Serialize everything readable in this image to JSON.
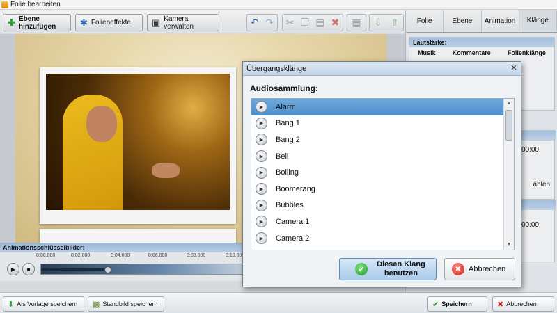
{
  "window": {
    "title": "Folie bearbeiten"
  },
  "toolbar": {
    "add_layer_label": "Ebene hinzufügen",
    "slide_effects_label": "Folieneffekte",
    "camera_label": "Kamera verwalten"
  },
  "right_panel": {
    "tabs": [
      {
        "label": "Folie"
      },
      {
        "label": "Ebene"
      },
      {
        "label": "Animation"
      },
      {
        "label": "Klänge"
      }
    ],
    "volume_header": "Lautstärke:",
    "volume_columns": [
      "Musik",
      "Kommentare",
      "Folienklänge"
    ],
    "time_value_1": "00:00",
    "time_value_2": "00:00",
    "select_label": "ählen"
  },
  "keyframes": {
    "header": "Animationsschlüsselbilder:",
    "ticks": [
      "0:00.000",
      "0:02.000",
      "0:04.000",
      "0:06.000",
      "0:08.000",
      "0:10.000"
    ],
    "progress": 0.33
  },
  "bottom": {
    "save_template_label": "Als Vorlage speichern",
    "save_image_label": "Standbild speichern",
    "save_label": "Speichern",
    "cancel_label": "Abbrechen"
  },
  "dialog": {
    "title": "Übergangsklänge",
    "collection_label": "Audiosammlung:",
    "items": [
      "Alarm",
      "Bang 1",
      "Bang 2",
      "Bell",
      "Boiling",
      "Boomerang",
      "Bubbles",
      "Camera 1",
      "Camera 2"
    ],
    "selected_index": 0,
    "use_button_label": "Diesen Klang benutzen",
    "cancel_button_label": "Abbrechen"
  },
  "colors": {
    "accent_blue": "#4e8fcb",
    "ok_green": "#1f9a27",
    "cancel_red": "#c8201a"
  },
  "icons": [
    "app-icon",
    "add-layer-icon",
    "effects-icon",
    "camera-icon",
    "undo-icon",
    "redo-icon",
    "cut-icon",
    "copy-icon",
    "paste-icon",
    "delete-icon",
    "play-icon",
    "stop-icon",
    "close-icon",
    "checkmark-icon",
    "cancel-icon",
    "scroll-up-icon",
    "scroll-down-icon"
  ]
}
